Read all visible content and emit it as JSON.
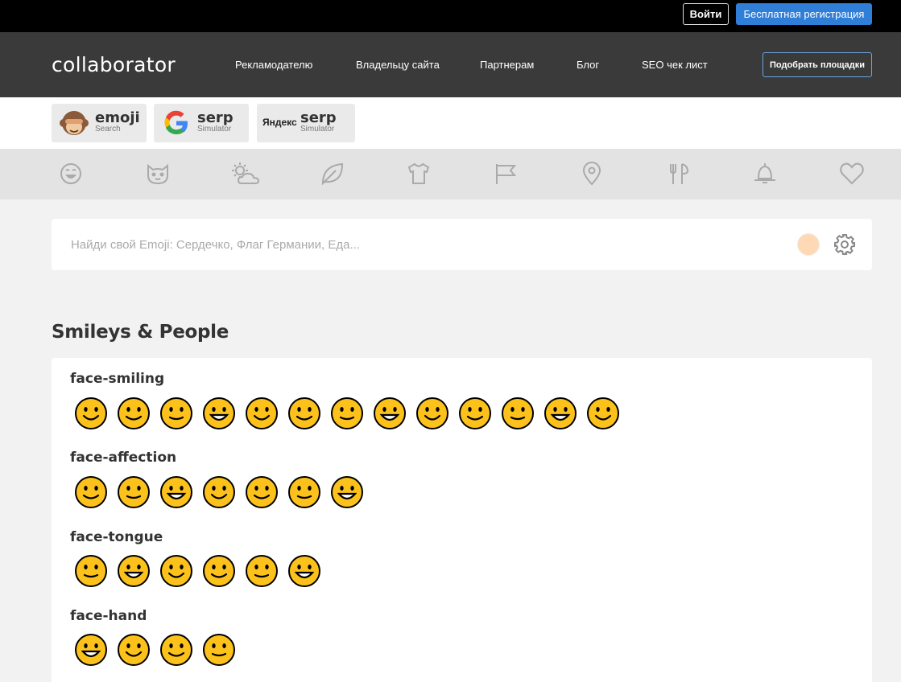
{
  "topbar": {
    "login": "Войти",
    "register": "Бесплатная регистрация"
  },
  "nav": {
    "logo": "collaborator",
    "links": [
      "Рекламодателю",
      "Владельцу сайта",
      "Партнерам",
      "Блог",
      "SEO чек лист"
    ],
    "cta": "Подобрать площадки"
  },
  "tools": [
    {
      "name": "emoji",
      "sub": "Search"
    },
    {
      "name": "serp",
      "sub": "Simulator",
      "brand": "G"
    },
    {
      "name": "serp",
      "sub": "Simulator",
      "brand": "Яндекс"
    }
  ],
  "categories": [
    "smiley-icon",
    "cat-icon",
    "weather-icon",
    "leaf-icon",
    "tshirt-icon",
    "flag-icon",
    "location-pin-icon",
    "fork-icon",
    "bell-icon",
    "heart-icon"
  ],
  "search": {
    "placeholder": "Найди свой Emoji: Сердечко, Флаг Германии, Еда..."
  },
  "section": "Smileys & People",
  "groups": [
    {
      "title": "face-smiling",
      "count": 13
    },
    {
      "title": "face-affection",
      "count": 7
    },
    {
      "title": "face-tongue",
      "count": 6
    },
    {
      "title": "face-hand",
      "count": 4
    }
  ],
  "colors": {
    "nav": "#3a3a3a",
    "accent": "#2f7fd8",
    "emoji_fill": "#fcc21b"
  }
}
